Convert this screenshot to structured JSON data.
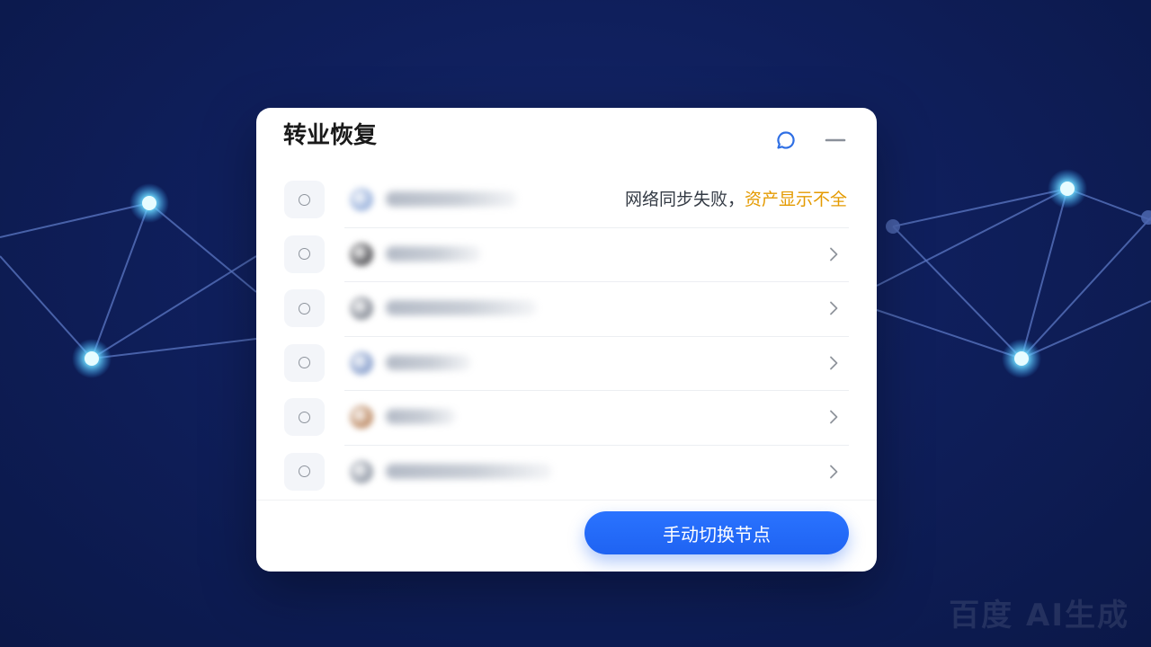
{
  "dialog": {
    "title": "转业恢复",
    "status": {
      "prefix": "网络同步失败，",
      "warning": "资产显示不全"
    },
    "rows": [
      {
        "avatar_color": "#9fb6de",
        "label_width": 0.26
      },
      {
        "avatar_color": "#5a5a5e",
        "label_width": 0.19
      },
      {
        "avatar_color": "#8e939d",
        "label_width": 0.3
      },
      {
        "avatar_color": "#8ea4cf",
        "label_width": 0.17
      },
      {
        "avatar_color": "#c0906c",
        "label_width": 0.14
      },
      {
        "avatar_color": "#9aa1ad",
        "label_width": 0.33
      }
    ],
    "primary_button": "手动切换节点"
  },
  "watermark": "百度 AI生成",
  "colors": {
    "background": "#0f1f5c",
    "accent": "#1f63f2",
    "warning": "#e49a00",
    "node_glow": "#7fe3ff"
  },
  "icons": {
    "header_support": "chat-bubble-icon",
    "header_minimize": "minimize-icon",
    "row_action": "chevron-right-icon"
  }
}
